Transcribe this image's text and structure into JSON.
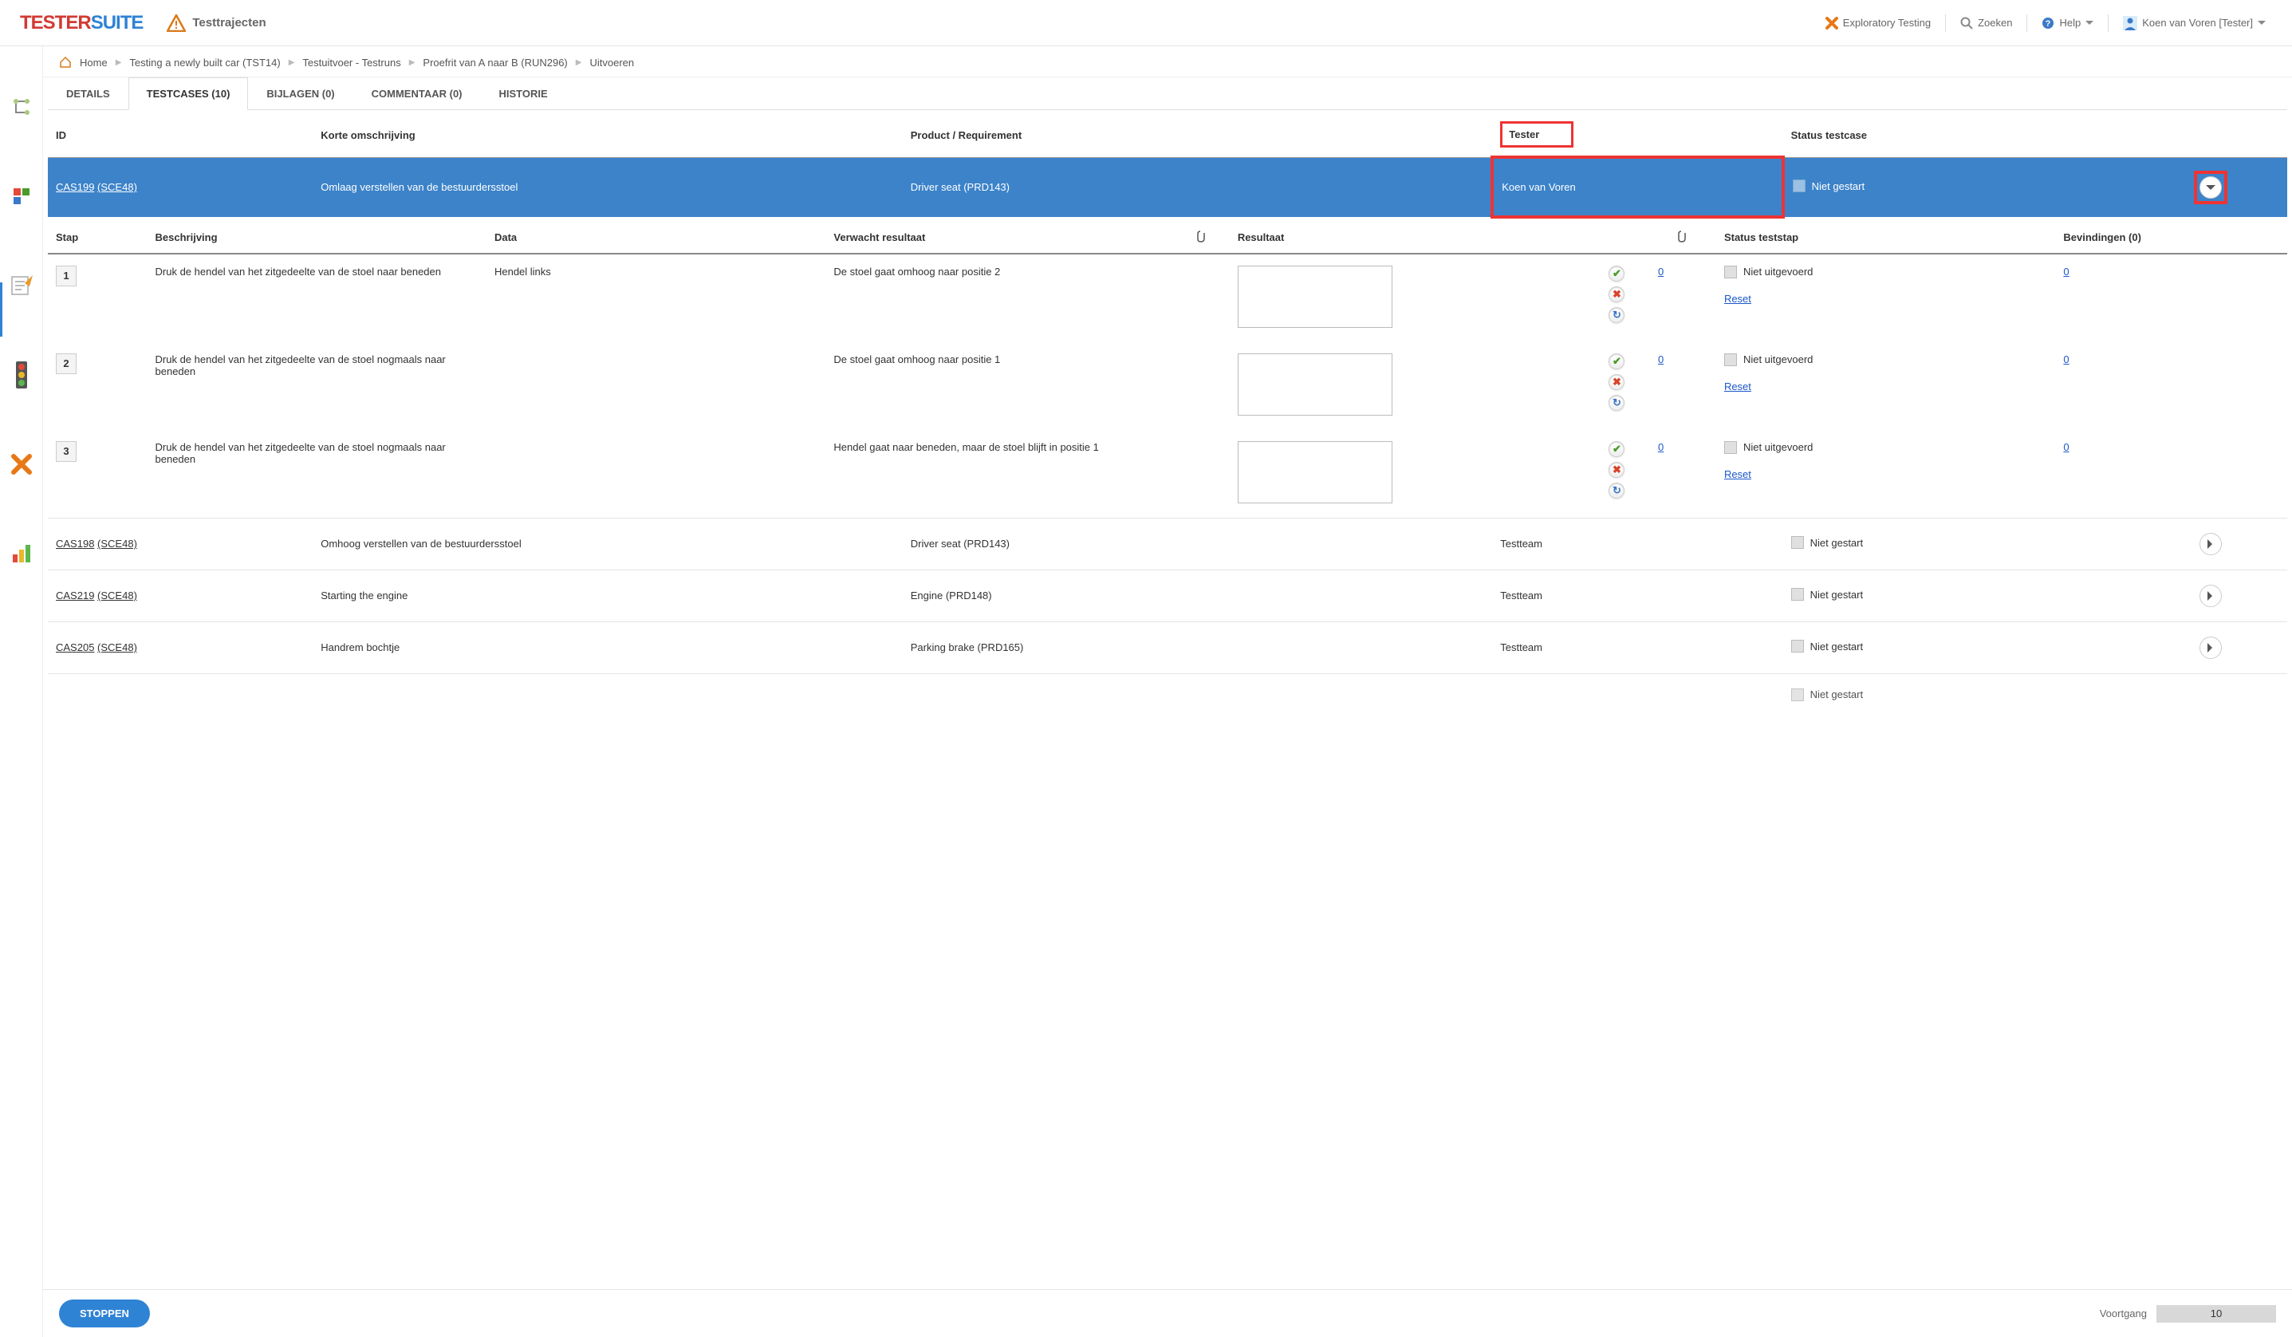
{
  "logo": {
    "t1": "TESTER",
    "t2": "SUITE"
  },
  "page_title": "Testtrajecten",
  "topnav": {
    "exploratory": "Exploratory Testing",
    "search": "Zoeken",
    "help": "Help",
    "user": "Koen van Voren [Tester]"
  },
  "breadcrumb": {
    "home": "Home",
    "project": "Testing a newly built car (TST14)",
    "section": "Testuitvoer - Testruns",
    "run": "Proefrit van A naar B (RUN296)",
    "action": "Uitvoeren"
  },
  "tabs": {
    "details": "DETAILS",
    "testcases": "TESTCASES (10)",
    "bijlagen": "BIJLAGEN (0)",
    "commentaar": "COMMENTAAR (0)",
    "historie": "HISTORIE"
  },
  "headers": {
    "id": "ID",
    "korte": "Korte omschrijving",
    "product": "Product / Requirement",
    "tester": "Tester",
    "status": "Status testcase"
  },
  "active_case": {
    "cas": "CAS199",
    "sce": "(SCE48)",
    "desc": "Omlaag verstellen van de bestuurdersstoel",
    "product": "Driver seat (PRD143)",
    "tester": "Koen van Voren",
    "status": "Niet gestart"
  },
  "step_headers": {
    "stap": "Stap",
    "beschrijving": "Beschrijving",
    "data": "Data",
    "verwacht": "Verwacht resultaat",
    "resultaat": "Resultaat",
    "status": "Status teststap",
    "bevindingen": "Bevindingen (0)"
  },
  "step_common": {
    "status": "Niet uitgevoerd",
    "reset": "Reset",
    "att_count": "0",
    "bev_count": "0"
  },
  "steps": [
    {
      "n": "1",
      "desc": "Druk de hendel van het zitgedeelte van de stoel naar beneden",
      "data": "Hendel links",
      "expect": "De stoel gaat omhoog naar positie 2"
    },
    {
      "n": "2",
      "desc": "Druk de hendel van het zitgedeelte van de stoel nogmaals naar beneden",
      "data": "",
      "expect": "De stoel gaat omhoog naar positie 1"
    },
    {
      "n": "3",
      "desc": "Druk de hendel van het zitgedeelte van de stoel nogmaals naar beneden",
      "data": "",
      "expect": "Hendel gaat naar beneden, maar de stoel blijft in positie 1"
    }
  ],
  "other_cases": [
    {
      "cas": "CAS198",
      "sce": "(SCE48)",
      "desc": "Omhoog verstellen van de bestuurdersstoel",
      "product": "Driver seat (PRD143)",
      "tester": "Testteam",
      "status": "Niet gestart"
    },
    {
      "cas": "CAS219",
      "sce": "(SCE48)",
      "desc": "Starting the engine",
      "product": "Engine (PRD148)",
      "tester": "Testteam",
      "status": "Niet gestart"
    },
    {
      "cas": "CAS205",
      "sce": "(SCE48)",
      "desc": "Handrem bochtje",
      "product": "Parking brake (PRD165)",
      "tester": "Testteam",
      "status": "Niet gestart"
    }
  ],
  "partial_case": {
    "cas": "",
    "sce": "",
    "desc": "",
    "product": "",
    "tester": "",
    "status": "Niet gestart"
  },
  "footer": {
    "stop": "STOPPEN",
    "voortgang": "Voortgang",
    "value": "10"
  }
}
